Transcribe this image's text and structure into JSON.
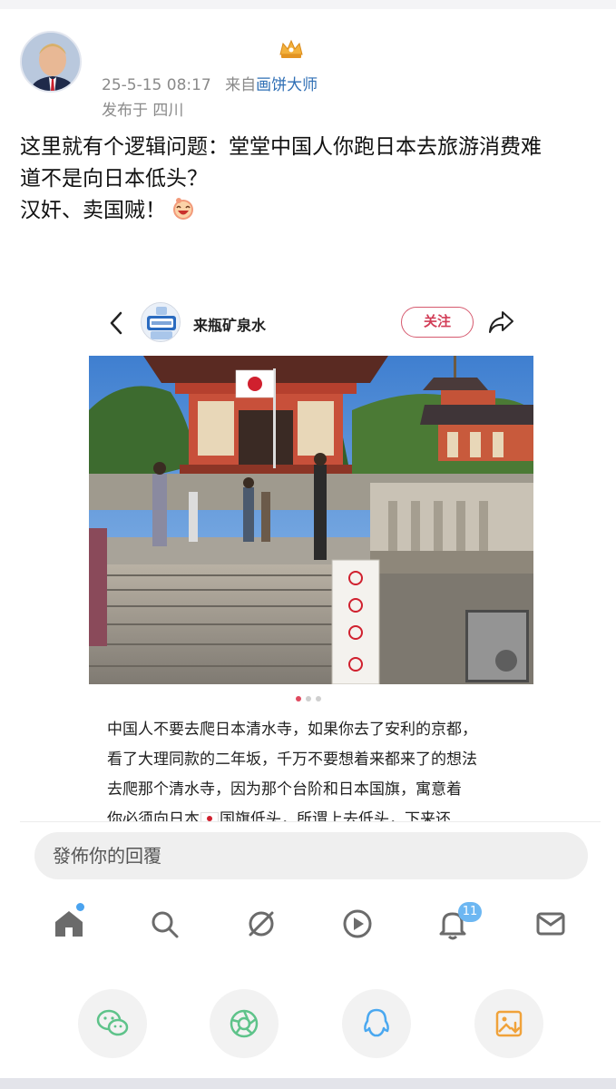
{
  "post": {
    "timestamp": "25-5-15 08:17",
    "source_prefix": "来自",
    "source_app": "画饼大师",
    "location": "发布于 四川",
    "text_lines": [
      "这里就有个逻辑问题：堂堂中国人你跑日本去旅游消费难",
      "道不是向日本低头？",
      "汉奸、卖国贼！"
    ]
  },
  "embedded": {
    "account_name": "来瓶矿泉水",
    "follow_label": "关注",
    "carousel": {
      "total": 3,
      "active": 1
    },
    "caption_lines": [
      "中国人不要去爬日本清水寺，如果你去了安利的京都，",
      "看了大理同款的二年坂，千万不要想着来都来了的想法",
      "去爬那个清水寺，因为那个台阶和日本国旗，寓意着",
      "你必须向日本"
    ],
    "caption_tail": "国旗低头，所谓上去低头，下来还"
  },
  "reply": {
    "placeholder": "發佈你的回覆"
  },
  "tabbar": {
    "items": [
      "home-icon",
      "search-icon",
      "discover-icon",
      "video-icon",
      "notifications-icon",
      "messages-icon"
    ],
    "notification_count": "11",
    "accent": "#4aa3ef"
  },
  "share_targets": [
    "wechat-icon",
    "moments-icon",
    "qq-icon",
    "save-image-icon"
  ],
  "colors": {
    "link": "#2f6fb5",
    "follow": "#d23d57",
    "wechat": "#5ec38a",
    "moments": "#5ec38a",
    "qq": "#4aa8f0",
    "save": "#f0a23a"
  }
}
